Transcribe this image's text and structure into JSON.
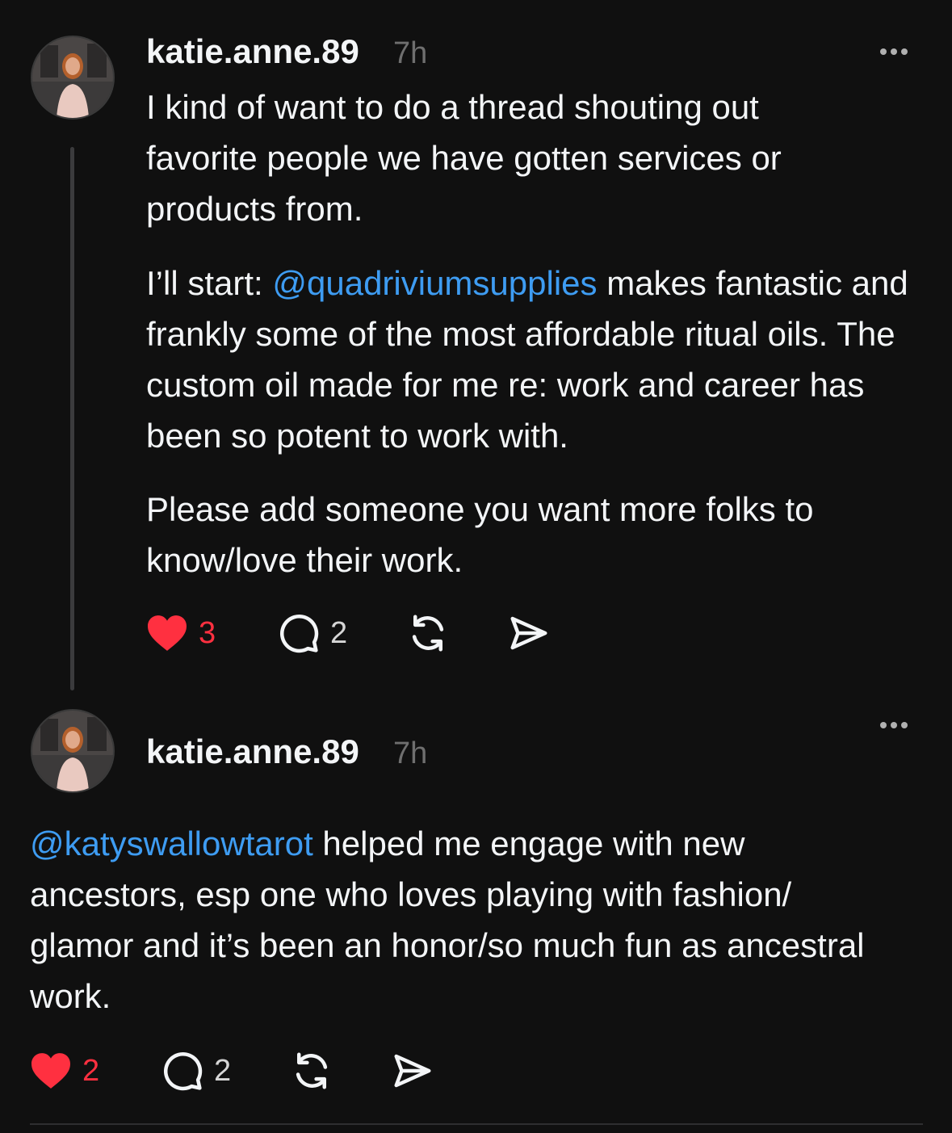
{
  "posts": [
    {
      "username": "katie.anne.89",
      "time": "7h",
      "avatar_icon": "profile-photo",
      "paragraphs": [
        {
          "segments": [
            {
              "text": "I kind of want to do a thread shouting out favorite people we have gotten services or products from."
            }
          ]
        },
        {
          "segments": [
            {
              "text": "I’ll start: "
            },
            {
              "text": "@quadriviumsupplies",
              "mention": true
            },
            {
              "text": " makes fantastic and frankly some of the most affordable ritual oils. The custom oil made for me re: work and career has been so potent to work with."
            }
          ]
        },
        {
          "segments": [
            {
              "text": "Please add someone you want more folks to know/love their work."
            }
          ]
        }
      ],
      "likes": "3",
      "liked": true,
      "replies": "2"
    },
    {
      "username": "katie.anne.89",
      "time": "7h",
      "avatar_icon": "profile-photo",
      "paragraphs": [
        {
          "segments": [
            {
              "text": "@katyswallowtarot",
              "mention": true
            },
            {
              "text": " helped me engage with new ancestors, esp one who loves playing with fashion/ glamor and it’s been an honor/so much fun as ancestral work."
            }
          ]
        }
      ],
      "likes": "2",
      "liked": true,
      "replies": "2"
    }
  ],
  "colors": {
    "background": "#101010",
    "text": "#f3f5f7",
    "muted": "#6f6f6f",
    "mention": "#3e9cf2",
    "like": "#ff3040",
    "thread_line": "#3b3b3d"
  }
}
